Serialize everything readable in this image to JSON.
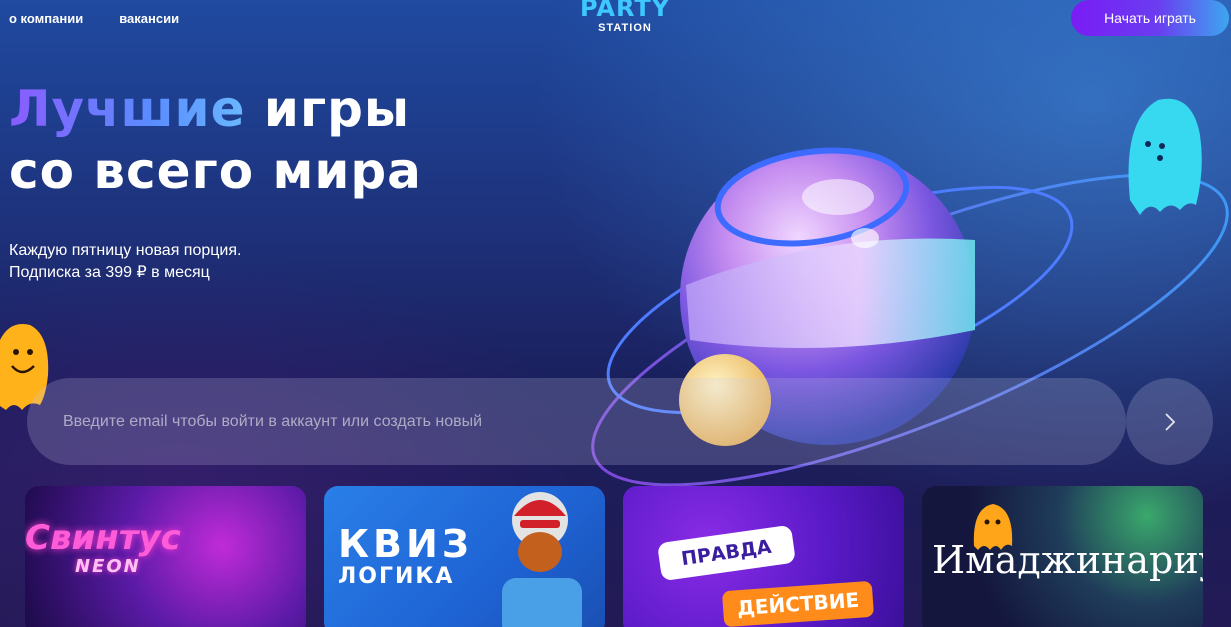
{
  "header": {
    "nav": [
      {
        "label": "о компании"
      },
      {
        "label": "вакансии"
      }
    ],
    "logo_top": "PARTY",
    "logo_bottom": "STATION",
    "play_button": "Начать играть"
  },
  "hero": {
    "title_accent": "Лучшие",
    "title_rest_1": " игры",
    "title_line_2": "со всего мира",
    "subtitle_line_1": "Каждую пятницу новая порция.",
    "subtitle_line_2": "Подписка за 399 ₽ в месяц"
  },
  "email": {
    "placeholder": "Введите email чтобы войти в аккаунт или создать новый",
    "value": ""
  },
  "cards": [
    {
      "title": "Свинтус",
      "subtitle": "NEON"
    },
    {
      "title": "КВИЗ",
      "subtitle": "ЛОГИКА"
    },
    {
      "title": "ПРАВДА",
      "subtitle": "ДЕЙСТВИЕ"
    },
    {
      "title": "Имаджинариум"
    }
  ],
  "colors": {
    "accent_cyan": "#3fc8ff",
    "button_purple": "#7a1cf5",
    "button_blue": "#3da6f0",
    "ghost_yellow": "#ffb21a",
    "ghost_cyan": "#37d9f0"
  },
  "icons": {
    "submit": "chevron-right-icon",
    "ghost_left": "yellow-ghost-icon",
    "ghost_right": "cyan-ghost-icon"
  }
}
